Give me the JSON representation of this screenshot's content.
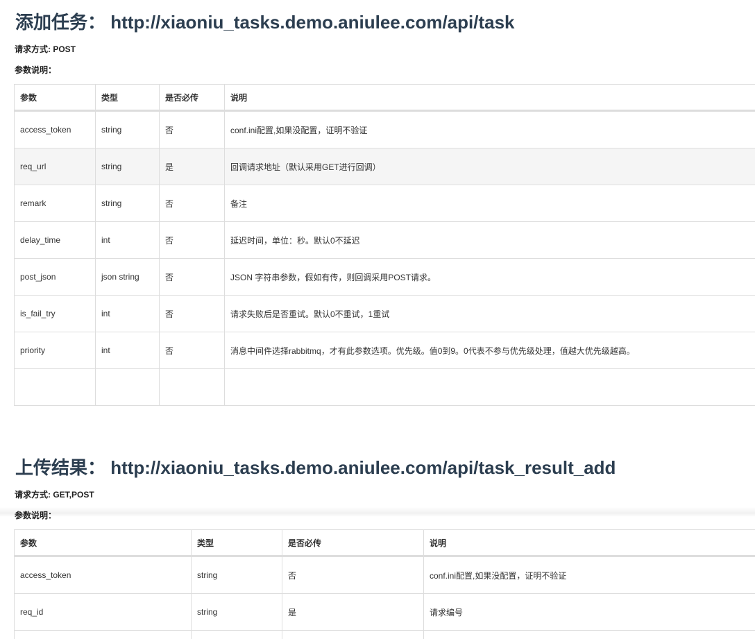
{
  "sections": [
    {
      "title": "添加任务： http://xiaoniu_tasks.demo.aniulee.com/api/task",
      "method": "请求方式: POST",
      "params_label": "参数说明：",
      "headers": [
        "参数",
        "类型",
        "是否必传",
        "说明"
      ],
      "rows": [
        [
          "access_token",
          "string",
          "否",
          "conf.ini配置,如果没配置，证明不验证"
        ],
        [
          "req_url",
          "string",
          "是",
          "回调请求地址（默认采用GET进行回调）"
        ],
        [
          "remark",
          "string",
          "否",
          "备注"
        ],
        [
          "delay_time",
          "int",
          "否",
          "延迟时间，单位：秒。默认0不延迟"
        ],
        [
          "post_json",
          "json string",
          "否",
          "JSON 字符串参数，假如有传，则回调采用POST请求。"
        ],
        [
          "is_fail_try",
          "int",
          "否",
          "请求失败后是否重试。默认0不重试，1重试"
        ],
        [
          "priority",
          "int",
          "否",
          "消息中间件选择rabbitmq，才有此参数选项。优先级。值0到9。0代表不参与优先级处理，值越大优先级越高。"
        ],
        [
          "",
          "",
          "",
          ""
        ]
      ]
    },
    {
      "title": "上传结果： http://xiaoniu_tasks.demo.aniulee.com/api/task_result_add",
      "method": "请求方式: GET,POST",
      "params_label": "参数说明：",
      "headers": [
        "参数",
        "类型",
        "是否必传",
        "说明"
      ],
      "rows": [
        [
          "access_token",
          "string",
          "否",
          "conf.ini配置,如果没配置，证明不验证"
        ],
        [
          "req_id",
          "string",
          "是",
          "请求编号"
        ],
        [
          "",
          "",
          "",
          ""
        ]
      ]
    }
  ]
}
